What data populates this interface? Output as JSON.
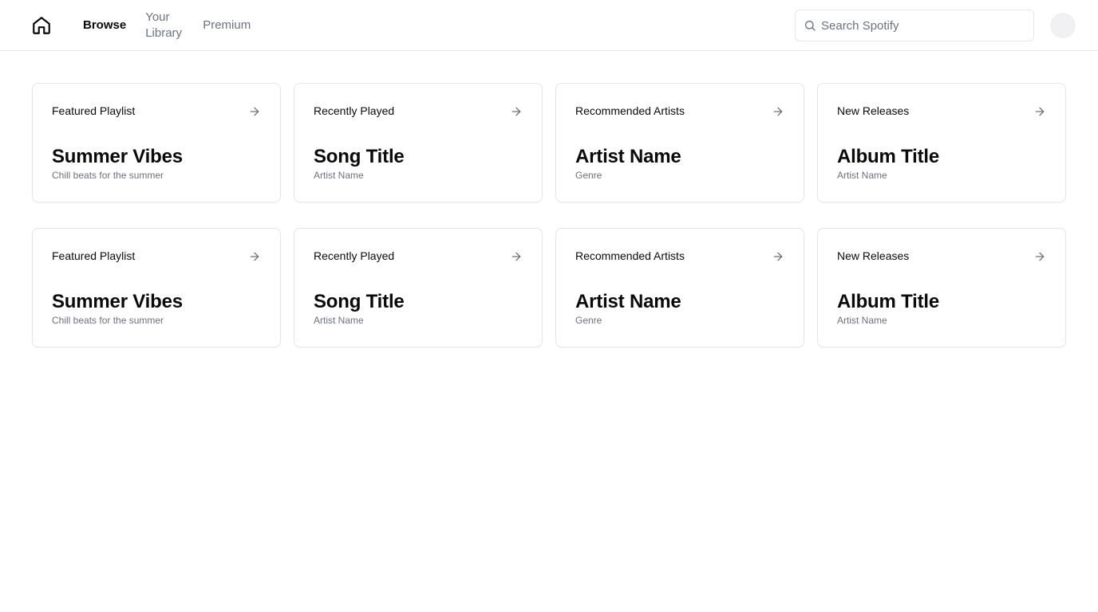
{
  "header": {
    "home_icon": "home-icon",
    "nav": [
      {
        "label": "Browse",
        "active": true
      },
      {
        "label": "Your Library",
        "active": false
      },
      {
        "label": "Premium",
        "active": false
      }
    ],
    "search": {
      "placeholder": "Search Spotify",
      "value": "",
      "icon": "search-icon"
    },
    "avatar_icon": "avatar"
  },
  "cards": [
    {
      "label": "Featured Playlist",
      "title": "Summer Vibes",
      "subtitle": "Chill beats for the summer",
      "icon": "arrow-right-icon"
    },
    {
      "label": "Recently Played",
      "title": "Song Title",
      "subtitle": "Artist Name",
      "icon": "arrow-right-icon"
    },
    {
      "label": "Recommended Artists",
      "title": "Artist Name",
      "subtitle": "Genre",
      "icon": "arrow-right-icon"
    },
    {
      "label": "New Releases",
      "title": "Album Title",
      "subtitle": "Artist Name",
      "icon": "arrow-right-icon"
    },
    {
      "label": "Featured Playlist",
      "title": "Summer Vibes",
      "subtitle": "Chill beats for the summer",
      "icon": "arrow-right-icon"
    },
    {
      "label": "Recently Played",
      "title": "Song Title",
      "subtitle": "Artist Name",
      "icon": "arrow-right-icon"
    },
    {
      "label": "Recommended Artists",
      "title": "Artist Name",
      "subtitle": "Genre",
      "icon": "arrow-right-icon"
    },
    {
      "label": "New Releases",
      "title": "Album Title",
      "subtitle": "Artist Name",
      "icon": "arrow-right-icon"
    }
  ],
  "colors": {
    "border": "#e5e7eb",
    "muted_text": "#6b7280",
    "text": "#0a0a0a"
  }
}
